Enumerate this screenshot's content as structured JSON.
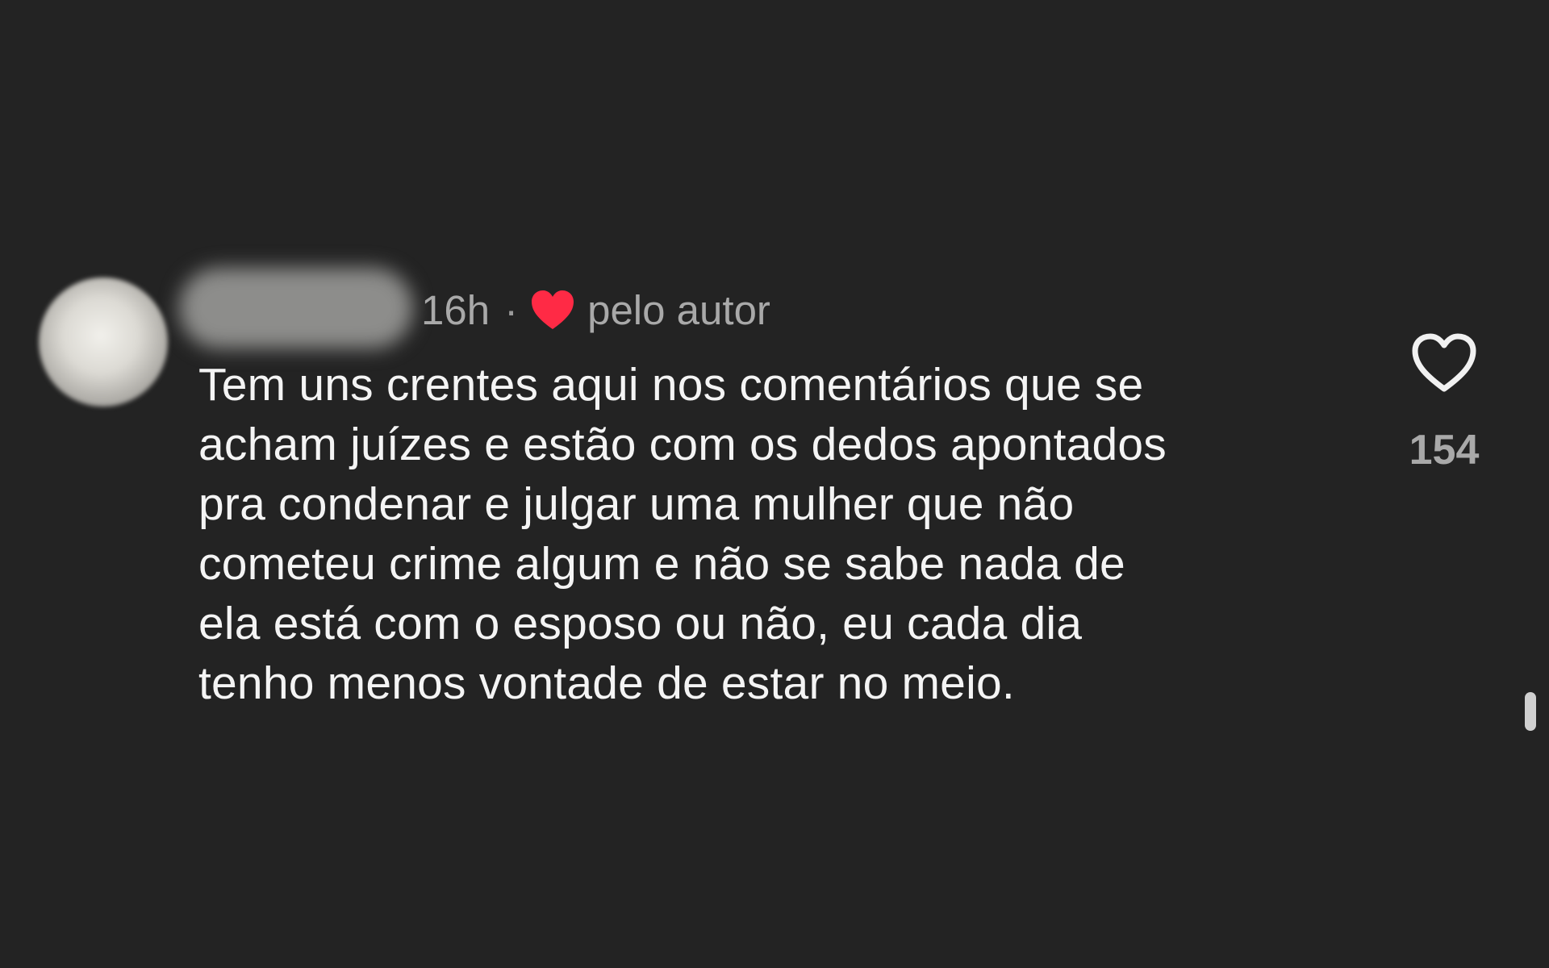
{
  "comment": {
    "time_label": "16h",
    "separator": "·",
    "liked_by_author_label": "pelo autor",
    "text": "Tem uns crentes aqui nos comentários que se\nacham juízes e estão com os dedos apontados\npra condenar e julgar uma mulher que não\ncometeu crime algum e não se sabe nada de\nela está com o esposo ou não, eu cada dia\ntenho menos vontade de estar no meio.",
    "like_count": "154",
    "author_heart_icon": "heart-filled-icon",
    "like_icon": "heart-outline-icon"
  },
  "colors": {
    "background": "#232323",
    "text": "#f4f4f4",
    "secondary_text": "#a9a9a9",
    "author_heart": "#ff2a45"
  }
}
